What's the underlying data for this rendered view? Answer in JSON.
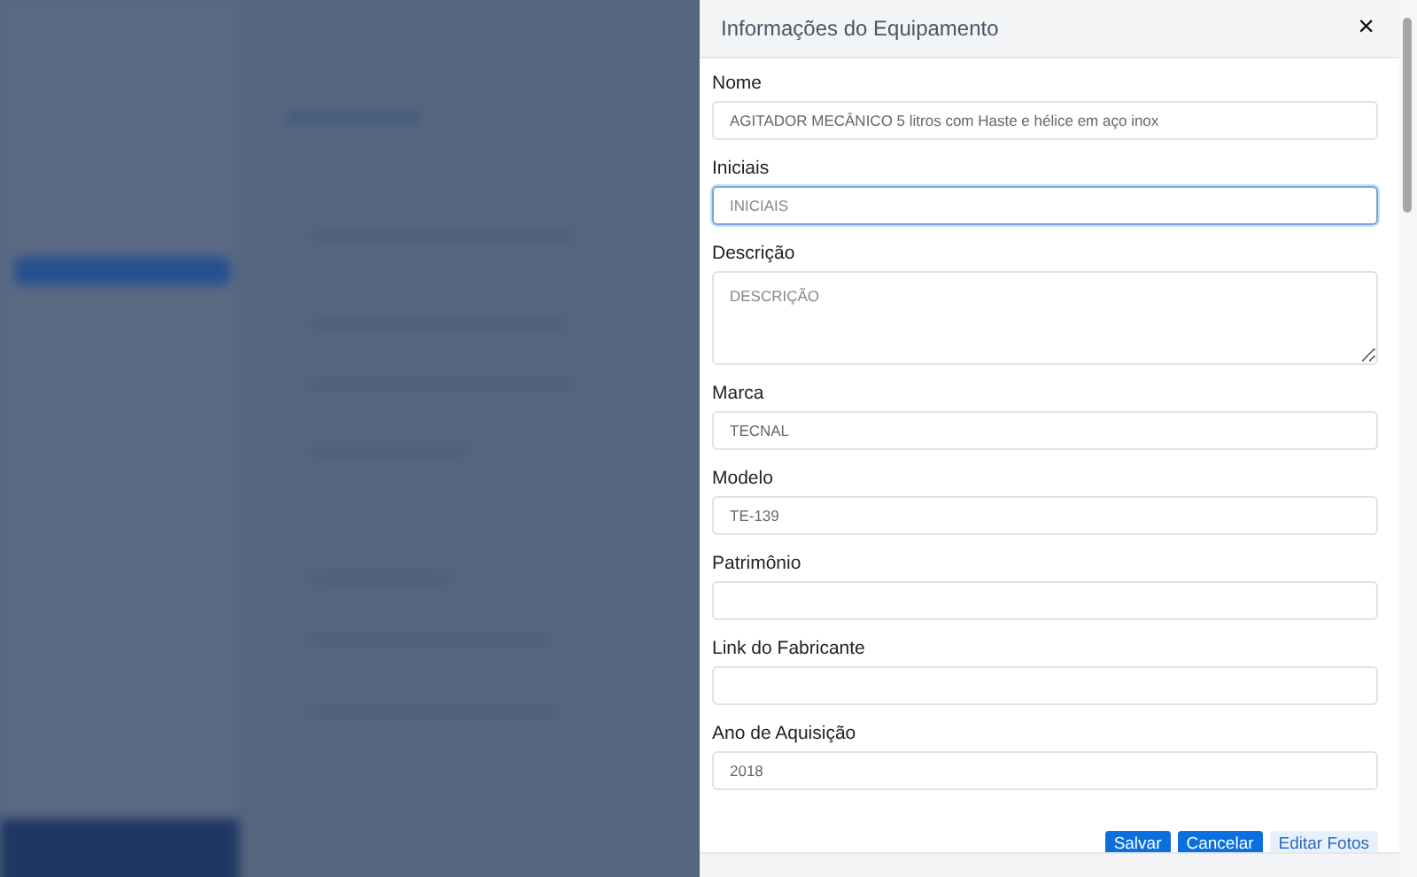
{
  "modal": {
    "title": "Informações do Equipamento",
    "close": "×"
  },
  "fields": [
    {
      "kind": "text",
      "label": "Nome",
      "value": "AGITADOR MECÂNICO 5 litros com Haste e hélice em aço inox",
      "focused": false
    },
    {
      "kind": "text",
      "label": "Iniciais",
      "placeholder": "INICIAIS",
      "focused": true
    },
    {
      "kind": "textarea",
      "label": "Descrição",
      "placeholder": "DESCRIÇÃO",
      "focused": false
    },
    {
      "kind": "text",
      "label": "Marca",
      "value": "TECNAL",
      "focused": false
    },
    {
      "kind": "text",
      "label": "Modelo",
      "value": "TE-139",
      "focused": false
    },
    {
      "kind": "text",
      "label": "Patrimônio",
      "focused": false
    },
    {
      "kind": "text",
      "label": "Link do Fabricante",
      "focused": false
    },
    {
      "kind": "text",
      "label": "Ano de Aquisição",
      "value": "2018",
      "focused": false
    }
  ],
  "buttons": [
    {
      "label": "Salvar",
      "kind": "primary"
    },
    {
      "label": "Cancelar",
      "kind": "primary"
    },
    {
      "label": "Editar Fotos",
      "kind": "light"
    }
  ]
}
